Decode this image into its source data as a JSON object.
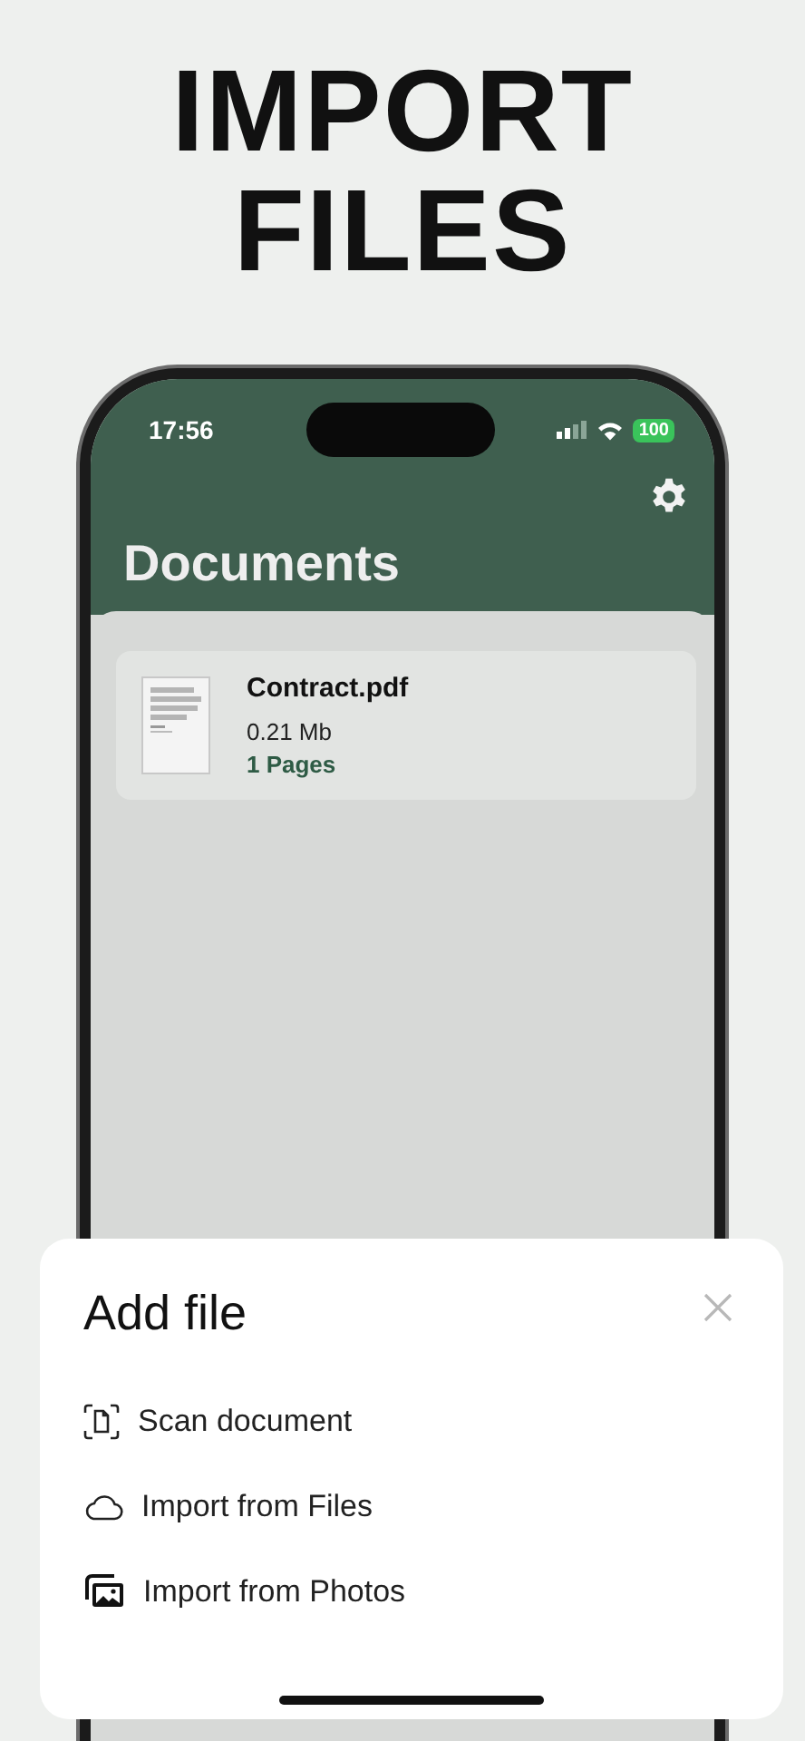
{
  "headline": "IMPORT FILES",
  "status_bar": {
    "time": "17:56",
    "battery": "100"
  },
  "screen": {
    "title": "Documents",
    "files": [
      {
        "name": "Contract.pdf",
        "size": "0.21 Mb",
        "pages": "1 Pages"
      }
    ]
  },
  "sheet": {
    "title": "Add file",
    "actions": [
      {
        "kind": "scan",
        "label": "Scan document"
      },
      {
        "kind": "files",
        "label": "Import from Files"
      },
      {
        "kind": "photos",
        "label": "Import from Photos"
      }
    ]
  }
}
